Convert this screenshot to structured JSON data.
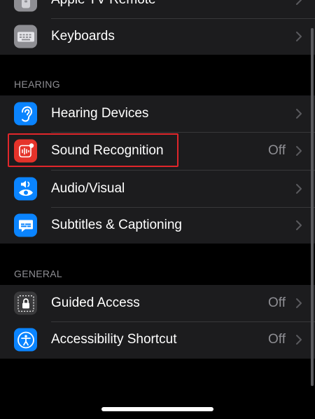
{
  "top_group": {
    "partial_item": {
      "label": "Apple TV Remote",
      "icon": "apple-tv-remote-icon",
      "icon_color": "#8e8e93"
    },
    "keyboards": {
      "label": "Keyboards",
      "icon": "keyboard-icon",
      "icon_color": "#8e8e93"
    }
  },
  "hearing": {
    "header": "HEARING",
    "items": [
      {
        "label": "Hearing Devices",
        "value": "",
        "icon": "ear-icon",
        "icon_color": "#0a84ff"
      },
      {
        "label": "Sound Recognition",
        "value": "Off",
        "icon": "sound-recognition-icon",
        "icon_color": "#e5332a"
      },
      {
        "label": "Audio/Visual",
        "value": "",
        "icon": "audio-visual-icon",
        "icon_color": "#0a84ff"
      },
      {
        "label": "Subtitles & Captioning",
        "value": "",
        "icon": "captions-icon",
        "icon_color": "#0a84ff"
      }
    ]
  },
  "general": {
    "header": "GENERAL",
    "items": [
      {
        "label": "Guided Access",
        "value": "Off",
        "icon": "lock-icon",
        "icon_color": "#3a3a3c"
      },
      {
        "label": "Accessibility Shortcut",
        "value": "Off",
        "icon": "accessibility-icon",
        "icon_color": "#0a84ff"
      }
    ]
  },
  "highlighted_item": "Sound Recognition"
}
